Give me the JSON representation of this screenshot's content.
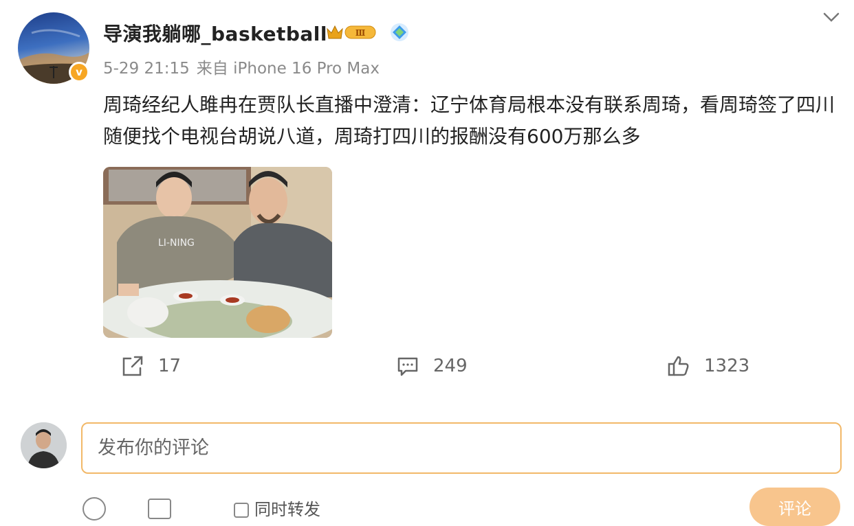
{
  "post": {
    "username": "导演我躺哪_basketball",
    "level_badge": "Ⅲ",
    "verified_mark": "v",
    "time": "5-29 21:15",
    "source": "来自 iPhone 16 Pro Max",
    "text": "周琦经纪人雎冉在贾队长直播中澄清：辽宁体育局根本没有联系周琦，看周琦签了四川随便找个电视台胡说八道，周琦打四川的报酬没有600万那么多"
  },
  "actions": {
    "repost_count": "17",
    "comment_count": "249",
    "like_count": "1323"
  },
  "comment_input": {
    "placeholder": "发布你的评论"
  },
  "footer": {
    "also_repost_label": "同时转发",
    "send_label": "评论"
  },
  "colors": {
    "accent_orange": "#f2b868",
    "verified_gold": "#f7a623",
    "meta_gray": "#8a8a8a"
  },
  "icons": [
    "chevron-down-icon",
    "crown-badge-icon",
    "blue-badge-icon",
    "share-icon",
    "comment-icon",
    "like-icon",
    "emoji-icon",
    "image-icon"
  ]
}
